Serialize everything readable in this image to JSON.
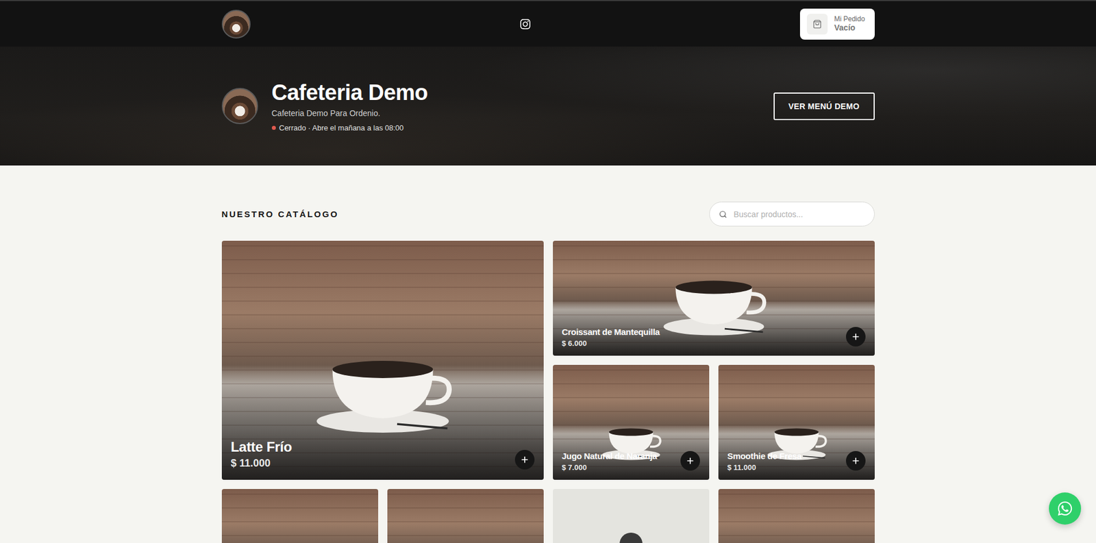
{
  "header": {
    "cart": {
      "label": "Mi Pedido",
      "status": "Vacío"
    }
  },
  "hero": {
    "title": "Cafeteria Demo",
    "subtitle": "Cafeteria Demo Para Ordenio.",
    "status": {
      "open": false,
      "text": "Cerrado · Abre el mañana a las 08:00"
    },
    "button": "VER MENÚ DEMO"
  },
  "catalog": {
    "title": "NUESTRO CATÁLOGO",
    "search": {
      "placeholder": "Buscar productos..."
    },
    "products": [
      {
        "kind": "photo",
        "name": "Latte Frío",
        "price": "$ 11.000"
      },
      {
        "kind": "photo",
        "name": "Croissant de Mantequilla",
        "price": "$ 6.000"
      },
      {
        "kind": "photo",
        "name": "Jugo Natural de Naranja",
        "price": "$ 7.000"
      },
      {
        "kind": "photo",
        "name": "Smoothie de Fresa",
        "price": "$ 11.000"
      },
      {
        "kind": "photo"
      },
      {
        "kind": "photo"
      },
      {
        "kind": "placeholder"
      },
      {
        "kind": "photo"
      }
    ]
  }
}
